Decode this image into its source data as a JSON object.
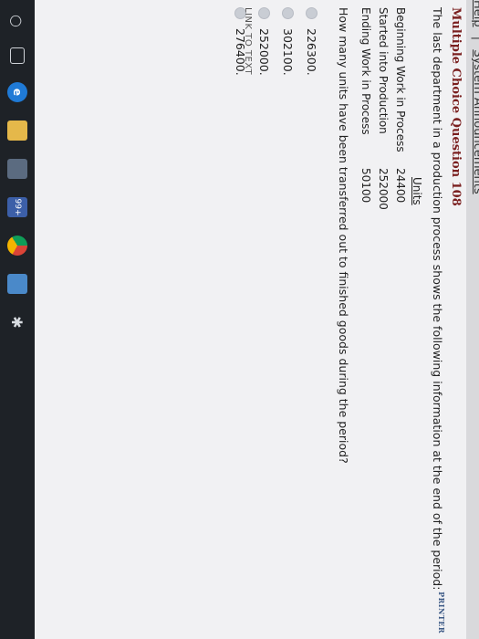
{
  "header": {
    "links": [
      "Help",
      "System Announcements"
    ],
    "separator": "|",
    "printer_label": "PRINTER"
  },
  "question": {
    "title": "Multiple Choice Question 108",
    "prompt": "The last department in a production process shows the following information at the end of the period:",
    "table_header": "Units",
    "rows": [
      {
        "label": "Beginning Work in Process",
        "value": "24400"
      },
      {
        "label": "Started into Production",
        "value": "252000"
      },
      {
        "label": "Ending Work in Process",
        "value": "50100"
      }
    ],
    "ask": "How many units have been transferred out to finished goods during the period?",
    "choices": [
      "226300.",
      "302100.",
      "252000.",
      "276400."
    ]
  },
  "footer": {
    "link_to_text": "LINK TO TEXT"
  },
  "taskbar": {
    "badge_text": "99+"
  }
}
